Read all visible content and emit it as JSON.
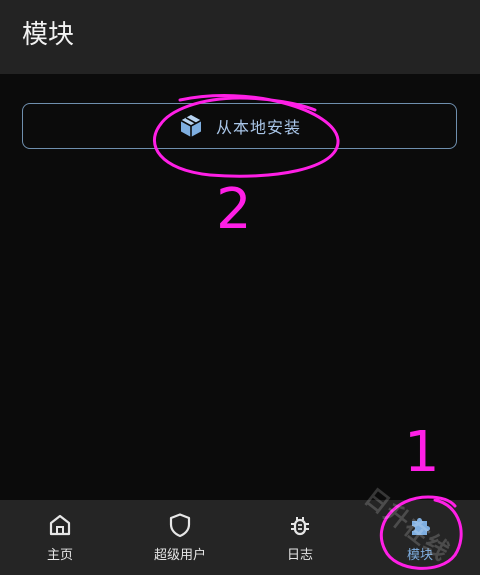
{
  "app_bar": {
    "title": "模块"
  },
  "main": {
    "install_button_label": "从本地安装"
  },
  "bottom_nav": {
    "items": [
      {
        "label": "主页",
        "icon": "home-icon",
        "active": false
      },
      {
        "label": "超级用户",
        "icon": "shield-icon",
        "active": false
      },
      {
        "label": "日志",
        "icon": "bug-icon",
        "active": false
      },
      {
        "label": "模块",
        "icon": "puzzle-icon",
        "active": true
      }
    ]
  },
  "annotations": {
    "first": "1",
    "second": "2"
  },
  "watermark": "日升在线",
  "colors": {
    "accent": "#7eaee0",
    "annotation": "#ff1fe6",
    "app_bar": "#232323",
    "background": "#0b0b0b"
  }
}
